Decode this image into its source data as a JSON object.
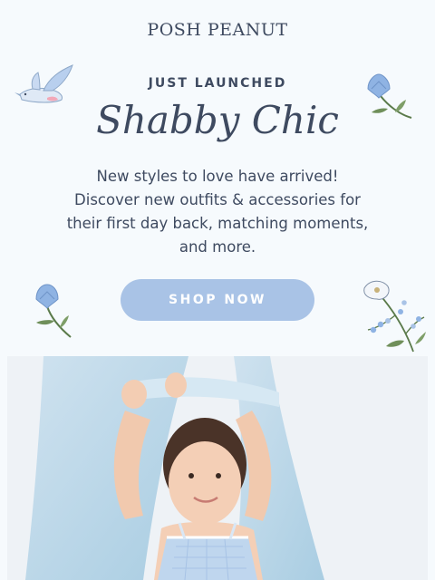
{
  "header": {
    "brand": "POSH PEANUT"
  },
  "hero": {
    "eyebrow": "JUST LAUNCHED",
    "title": "Shabby Chic",
    "body_lines": [
      "New styles to love have arrived!",
      "Discover new outfits & accessories for",
      "their first day back, matching moments,",
      "and more."
    ],
    "cta_label": "SHOP NOW"
  },
  "icons": [
    "bird-icon",
    "bluebell-flower-icon",
    "bluebell-flower-icon",
    "wildflower-sprig-icon"
  ],
  "colors": {
    "text": "#3e4a60",
    "button": "#a9c3e6",
    "background": "#f6fafd",
    "accent_blue": "#8fb3e3"
  }
}
